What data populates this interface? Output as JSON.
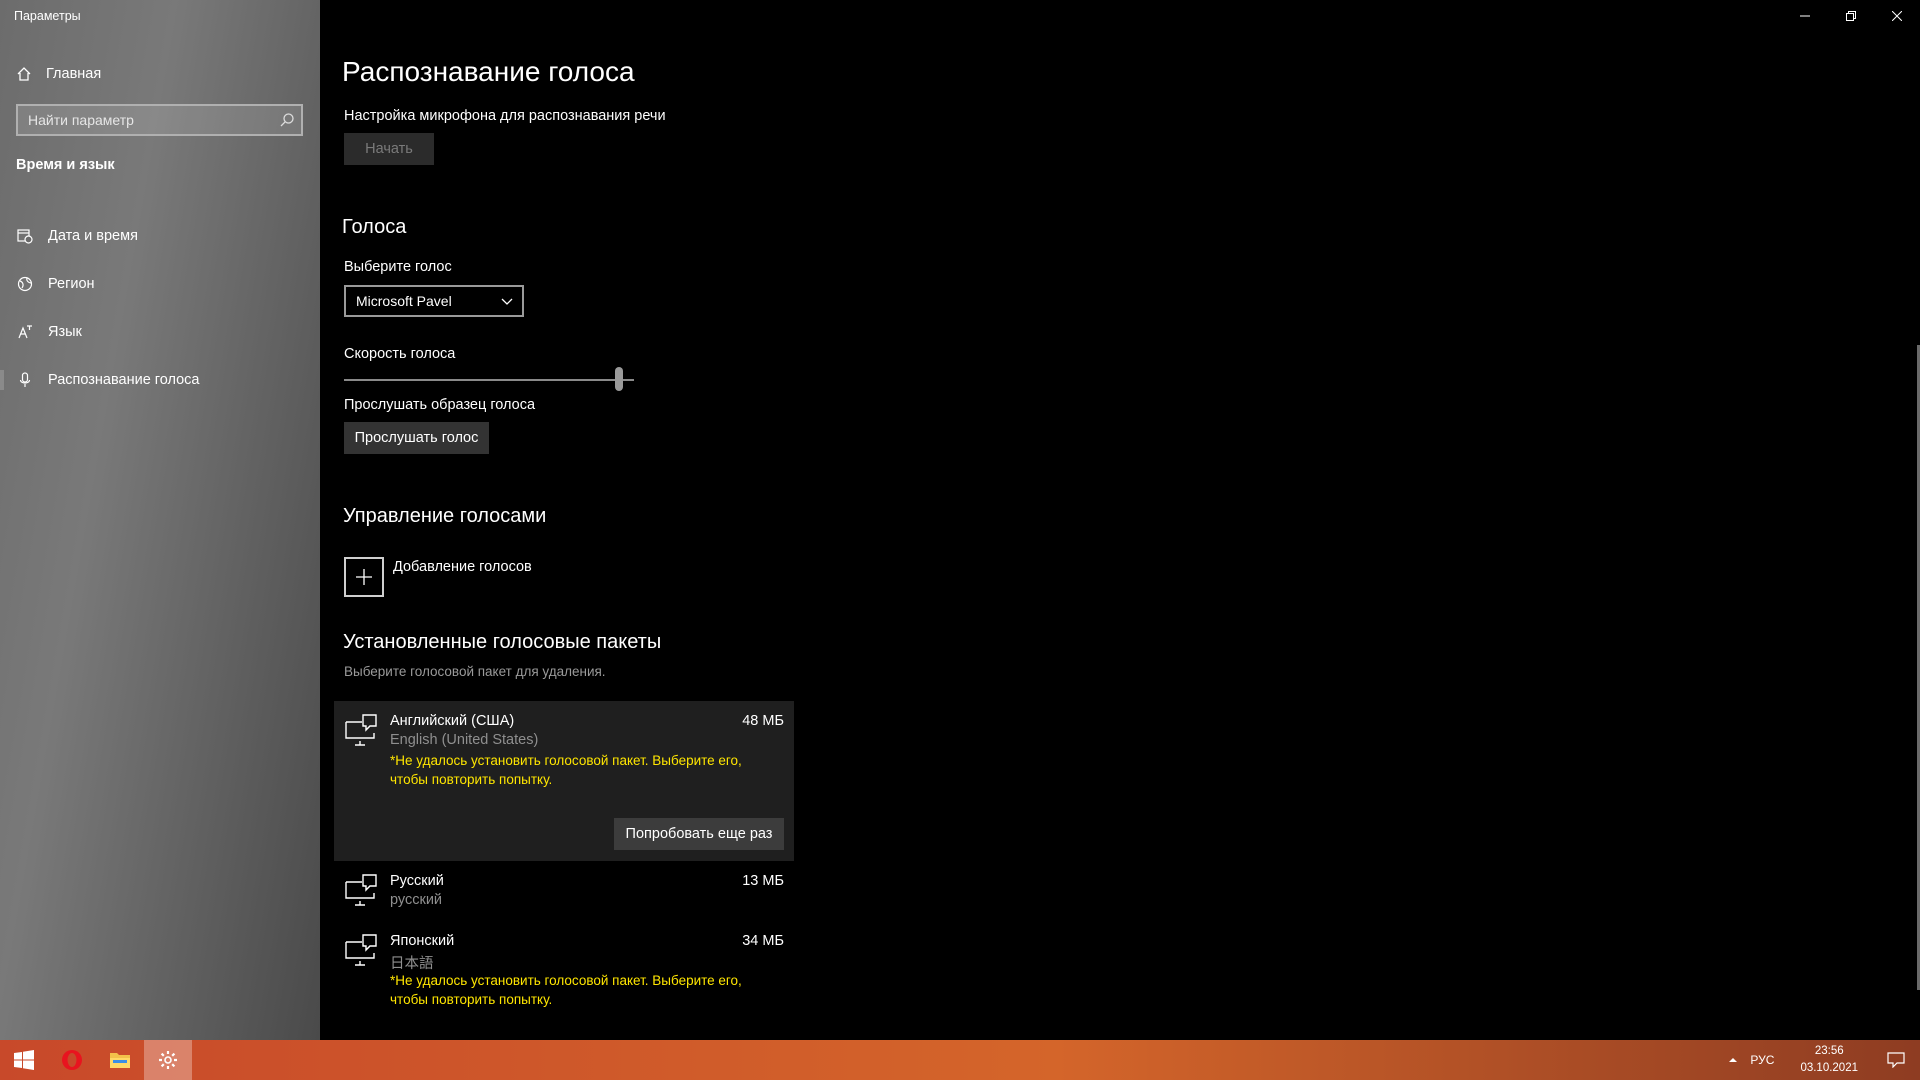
{
  "window": {
    "title": "Параметры"
  },
  "sidebar": {
    "home_label": "Главная",
    "search_placeholder": "Найти параметр",
    "section": "Время и язык",
    "items": [
      {
        "label": "Дата и время",
        "icon": "calendar-clock-icon"
      },
      {
        "label": "Регион",
        "icon": "globe-icon"
      },
      {
        "label": "Язык",
        "icon": "language-icon"
      },
      {
        "label": "Распознавание голоса",
        "icon": "microphone-icon",
        "active": true
      }
    ]
  },
  "main": {
    "title": "Распознавание голоса",
    "mic_setup_label": "Настройка микрофона для распознавания речи",
    "start_button": "Начать",
    "voices_heading": "Голоса",
    "choose_voice_label": "Выберите голос",
    "voice_selected": "Microsoft Pavel",
    "speed_label": "Скорость голоса",
    "speed_value": 1.0,
    "sample_label": "Прослушать образец голоса",
    "listen_button": "Прослушать голос",
    "manage_heading": "Управление голосами",
    "add_voices_label": "Добавление голосов",
    "installed_heading": "Установленные голосовые пакеты",
    "installed_hint": "Выберите голосовой пакет для удаления.",
    "packs": [
      {
        "name": "Английский (США)",
        "native": "English (United States)",
        "size": "48 МБ",
        "error_line1": "*Не удалось установить голосовой пакет. Выберите его,",
        "error_line2": "чтобы повторить попытку.",
        "retry_button": "Попробовать еще раз"
      },
      {
        "name": "Русский",
        "native": "русский",
        "size": "13 МБ"
      },
      {
        "name": "Японский",
        "native": "日本語",
        "size": "34 МБ",
        "error_line1": "*Не удалось установить голосовой пакет. Выберите его,",
        "error_line2": "чтобы повторить попытку."
      }
    ]
  },
  "taskbar": {
    "language": "РУС",
    "time": "23:56",
    "date": "03.10.2021"
  },
  "colors": {
    "error_text": "#ffe600",
    "taskbar": "#c8492a"
  }
}
